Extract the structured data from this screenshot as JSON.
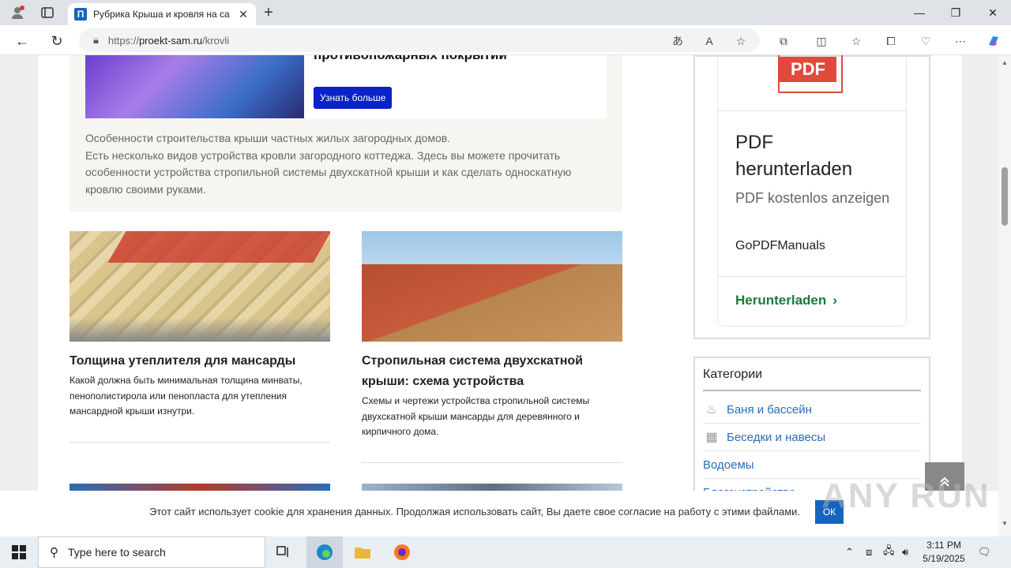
{
  "browser": {
    "tab_title": "Рубрика Крыша и кровля на са",
    "url_proto": "https://",
    "url_host": "proekt-sam.ru",
    "url_path": "/krovli"
  },
  "ad_banner": {
    "title": "противопожарных покрытий",
    "button": "Узнать больше"
  },
  "intro": {
    "line1": "Особенности строительства крыши частных жилых загородных домов.",
    "line2": "Есть несколько видов устройства кровли загородного коттеджа. Здесь вы можете прочитать особенности устройства стропильной системы двухскатной крыши и как сделать односкатную кровлю своими руками."
  },
  "articles": [
    {
      "title": "Толщина утеплителя для мансарды",
      "desc": "Какой должна быть минимальная толщина минваты, пенополистирола или пенопласта для утепления мансардной крыши изнутри."
    },
    {
      "title": "Стропильная система двухскатной крыши: схема устройства",
      "desc": "Схемы и чертежи устройства стропильной системы двухскатной крыши мансарды для деревянного и кирпичного дома."
    }
  ],
  "pdf_ad": {
    "icon_label": "PDF",
    "heading": "PDF herunterladen",
    "sub": "PDF kostenlos anzeigen",
    "brand": "GoPDFManuals",
    "link": "Herunterladen"
  },
  "categories": {
    "title": "Категории",
    "items": [
      {
        "label": "Баня и бассейн",
        "icon": "sauna-icon"
      },
      {
        "label": "Беседки и навесы",
        "icon": "gazebo-icon"
      },
      {
        "label": "Водоемы",
        "icon": ""
      },
      {
        "label": "Благоустройство",
        "icon": ""
      }
    ]
  },
  "cookie": {
    "text": "Этот сайт использует cookie для хранения данных. Продолжая использовать сайт, Вы даете свое согласие на работу с этими файлами.",
    "ok": "ОК"
  },
  "watermark": "ANY RUN",
  "taskbar": {
    "search_placeholder": "Type here to search",
    "time": "3:11 PM",
    "date": "5/19/2025"
  },
  "colors": {
    "link": "#2a6cb8",
    "ad_button": "#0a22c8",
    "pdf_red": "#e04a3a",
    "pdf_link_green": "#1a7a3a"
  }
}
